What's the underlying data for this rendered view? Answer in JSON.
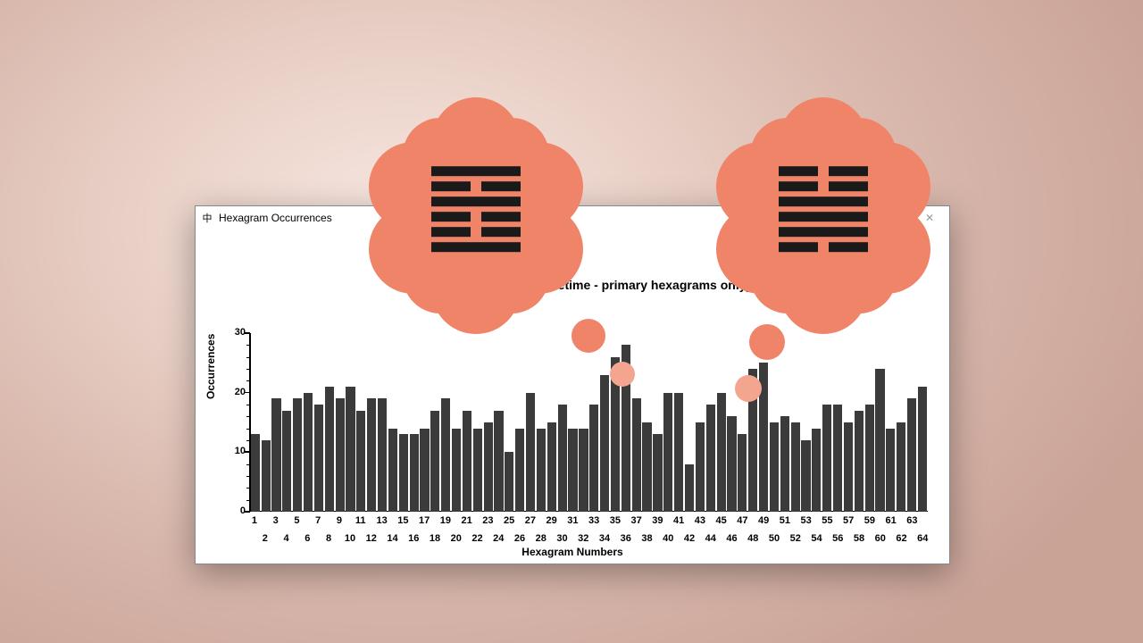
{
  "window": {
    "title": "Hexagram Occurrences",
    "icon_glyph": "中",
    "controls": {
      "minimize": "–",
      "maximize": "▢",
      "close": "✕"
    }
  },
  "chart_data": {
    "type": "bar",
    "title": "Hexagram Occurrences (Lifetime -  primary hexagrams only)",
    "xlabel": "Hexagram Numbers",
    "ylabel": "Occurrences",
    "categories": [
      1,
      2,
      3,
      4,
      5,
      6,
      7,
      8,
      9,
      10,
      11,
      12,
      13,
      14,
      15,
      16,
      17,
      18,
      19,
      20,
      21,
      22,
      23,
      24,
      25,
      26,
      27,
      28,
      29,
      30,
      31,
      32,
      33,
      34,
      35,
      36,
      37,
      38,
      39,
      40,
      41,
      42,
      43,
      44,
      45,
      46,
      47,
      48,
      49,
      50,
      51,
      52,
      53,
      54,
      55,
      56,
      57,
      58,
      59,
      60,
      61,
      62,
      63,
      64
    ],
    "values": [
      13,
      12,
      19,
      17,
      19,
      20,
      18,
      21,
      19,
      21,
      17,
      19,
      19,
      14,
      13,
      13,
      14,
      17,
      19,
      14,
      17,
      14,
      15,
      17,
      10,
      14,
      20,
      14,
      15,
      18,
      14,
      14,
      18,
      23,
      26,
      28,
      19,
      15,
      13,
      20,
      20,
      8,
      15,
      18,
      20,
      16,
      13,
      24,
      25,
      15,
      16,
      15,
      12,
      14,
      18,
      18,
      15,
      17,
      18,
      24,
      14,
      15,
      19,
      21
    ],
    "ylim": [
      0,
      30
    ],
    "y_major_ticks": [
      0,
      10,
      20,
      30
    ],
    "y_minor_ticks": [
      2,
      4,
      6,
      8,
      12,
      14,
      16,
      18,
      22,
      24,
      26,
      28
    ],
    "highlights": [
      {
        "hexagram": 36,
        "lines": [
          "solid",
          "broken",
          "solid",
          "broken",
          "broken",
          "solid"
        ]
      },
      {
        "hexagram": 49,
        "lines": [
          "broken",
          "broken",
          "solid",
          "solid",
          "solid",
          "broken"
        ]
      }
    ]
  },
  "colors": {
    "bubble": "#f08469",
    "bar": "#3b3b3b"
  }
}
